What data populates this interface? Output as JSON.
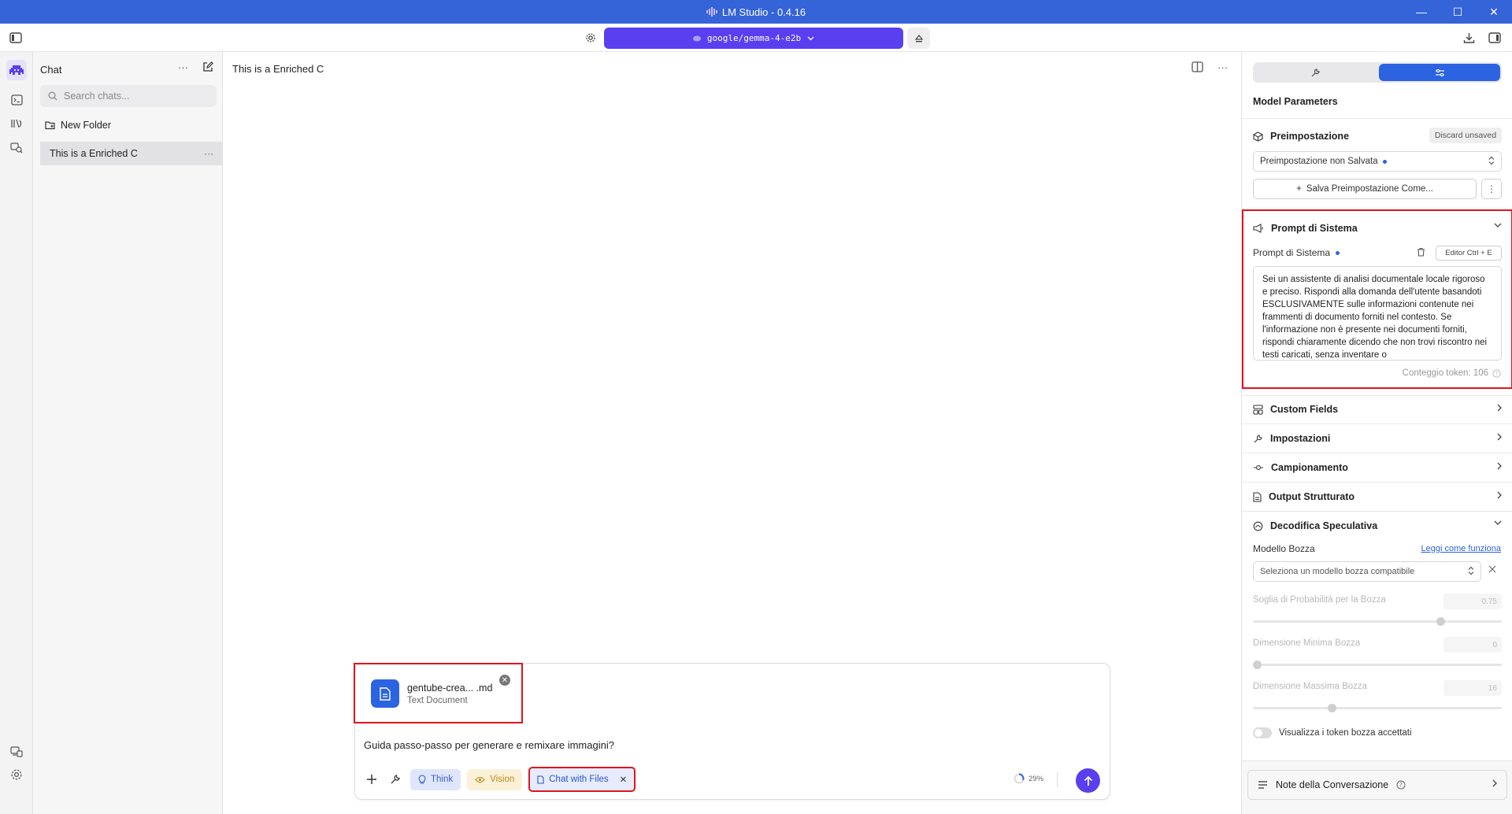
{
  "window": {
    "title": "LM Studio - 0.4.16",
    "controls": [
      "—",
      "☐",
      "✕"
    ]
  },
  "toolbar": {
    "model": "google/gemma-4-e2b"
  },
  "sidebar": {
    "title": "Chat",
    "search_placeholder": "Search chats...",
    "new_folder": "New Folder",
    "chats": [
      {
        "title": "This is a Enriched C"
      }
    ]
  },
  "main": {
    "title": "This is a Enriched C",
    "attachment": {
      "name": "gentube-crea... .md",
      "type": "Text Document"
    },
    "prompt": "Guida passo-passo per generare e remixare immagini?",
    "chips": {
      "think": "Think",
      "vision": "Vision",
      "files": "Chat with Files"
    },
    "context_usage": "29%"
  },
  "right": {
    "heading": "Model Parameters",
    "preset": {
      "title": "Preimpostazione",
      "discard": "Discard unsaved",
      "selected": "Preimpostazione non Salvata",
      "save": "Salva Preimpostazione Come..."
    },
    "system_prompt": {
      "title": "Prompt di Sistema",
      "label": "Prompt di Sistema",
      "editor": "Editor  Ctrl + E",
      "text": "Sei un assistente di analisi documentale locale rigoroso e preciso. Rispondi alla domanda dell'utente basandoti ESCLUSIVAMENTE sulle informazioni contenute nei frammenti di documento forniti nel contesto. Se l'informazione non è presente nei documenti forniti, rispondi chiaramente dicendo che non trovi riscontro nei testi caricati, senza inventare o",
      "tokens": "Conteggio token: 106"
    },
    "sections": {
      "custom_fields": "Custom Fields",
      "impostazioni": "Impostazioni",
      "campionamento": "Campionamento",
      "output": "Output Strutturato",
      "speculative": "Decodifica Speculativa"
    },
    "speculative": {
      "draft_model": "Modello Bozza",
      "learn_link": "Leggi come funziona",
      "draft_placeholder": "Seleziona un modello bozza compatibile",
      "prob_threshold": "Soglia di Probabilità per la Bozza",
      "prob_value": "0.75",
      "min_size": "Dimensione Minima Bozza",
      "min_value": "0",
      "max_size": "Dimensione Massima Bozza",
      "max_value": "16",
      "show_tokens": "Visualizza i token bozza accettati"
    },
    "notes": "Note della Conversazione"
  }
}
